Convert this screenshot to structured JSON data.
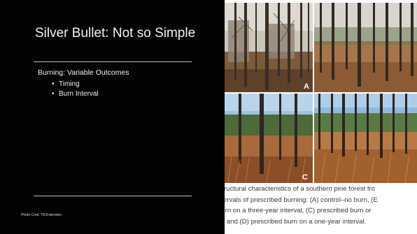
{
  "slide": {
    "title": "Silver Bullet: Not so Simple",
    "subheading": "Burning: Variable Outcomes",
    "bullets": [
      "Timing",
      "Burn Interval"
    ],
    "photo_credit": "Photo Cred: TN Extension"
  },
  "figure": {
    "panels": [
      {
        "label": "A"
      },
      {
        "label": ""
      },
      {
        "label": "C"
      },
      {
        "label": ""
      }
    ],
    "caption_lines": [
      "Structural characteristics of a southern pine forest fro",
      "ntervals of prescribed burning: (A) control–no burn, (E",
      "burn on a three-year interval, (C) prescribed burn or",
      "al, and (D) prescribed burn on a one-year interval."
    ]
  },
  "colors": {
    "background": "#000000",
    "text": "#f0f0f0",
    "rule": "#bdbdbd",
    "caption": "#3a3a3a"
  }
}
